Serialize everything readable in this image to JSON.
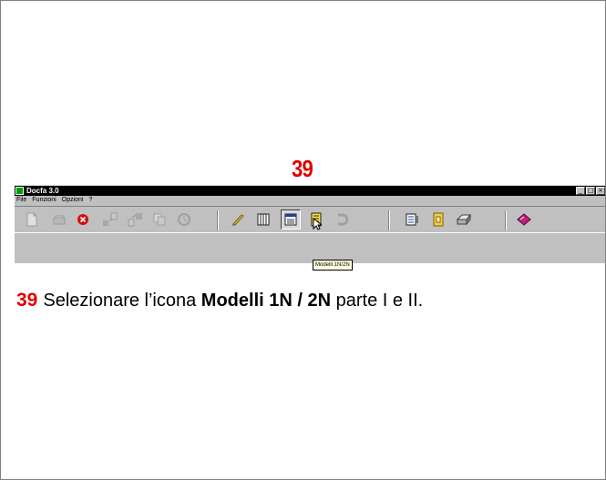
{
  "step_number": "39",
  "window": {
    "title": "Docfa 3.0",
    "buttons": {
      "minimize": "_",
      "maximize": "□",
      "close": "×"
    }
  },
  "menu": [
    "File",
    "Funzioni",
    "Opzioni",
    "?"
  ],
  "toolbar": {
    "tooltip": "Modelli 1N/2N",
    "icons": [
      "new-document-icon",
      "open-icon",
      "delete-icon",
      "import-icon",
      "export-icon",
      "copy-icon",
      "recycle-icon",
      "edit-pen-icon",
      "registry-icon",
      "models-1n-2n-icon",
      "list-icon",
      "magnet-icon",
      "document-list-icon",
      "notebook-icon",
      "print-icon",
      "help-book-icon"
    ]
  },
  "instruction": {
    "number": "39",
    "prefix": "Selezionare l’icona ",
    "bold": "Modelli 1N / 2N",
    "suffix": " parte I e II."
  },
  "colors": {
    "accent": "#e00000",
    "titlebar": "#000000",
    "toolbar": "#c0c0c0"
  }
}
